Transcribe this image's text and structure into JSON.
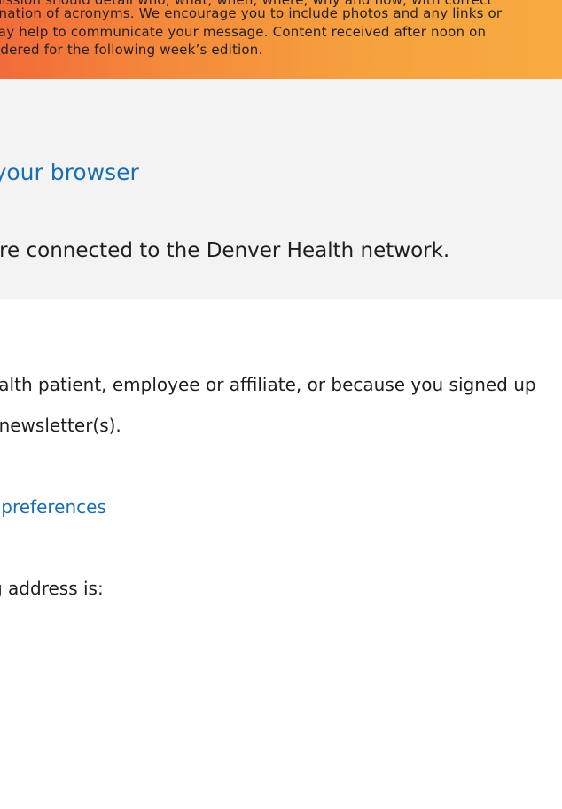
{
  "banner": {
    "lines": [
      "submission should detail who, what, when, where, why and how, with correct",
      "planation of acronyms. We encourage you to include photos and any links or",
      "may help to communicate your message. Content received after noon on",
      "sidered for the following week’s edition."
    ],
    "colors": [
      "#f26b3a",
      "#f7ab40"
    ]
  },
  "view_in_browser": {
    "label": "il in your browser"
  },
  "network_note": {
    "text": "are connected to the Denver Health network."
  },
  "footer": {
    "reason_line1": "ealth patient, employee or affiliate, or because you signed up",
    "reason_line2": "r newsletter(s).",
    "preferences_link": "ur preferences",
    "mailing_address_label": "g address is:"
  },
  "colors": {
    "link": "#1a6fb0",
    "text": "#1e1e1e",
    "band": "#f3f3f3"
  }
}
